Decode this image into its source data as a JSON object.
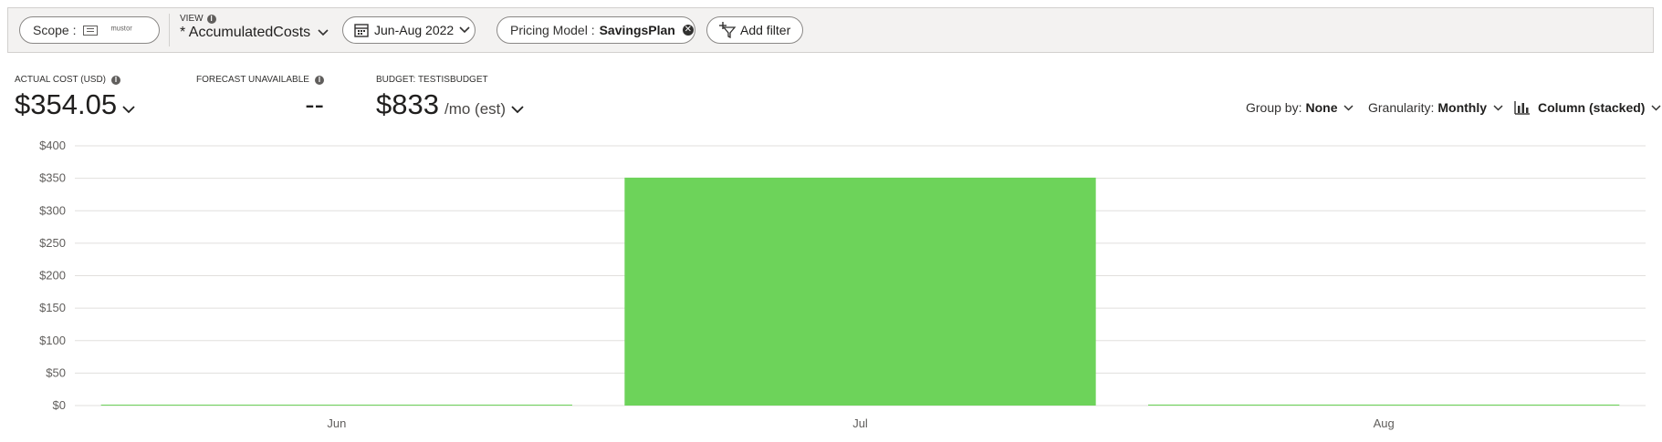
{
  "toolbar": {
    "scope_label": "Scope :",
    "scope_value": "ᵐᵘˢᵗᵒʳ",
    "view_caption": "VIEW",
    "view_name": "* AccumulatedCosts",
    "date_range": "Jun-Aug 2022",
    "filter_label": "Pricing Model :",
    "filter_value": "SavingsPlan",
    "add_filter_label": "Add filter"
  },
  "kpis": {
    "actual_caption": "ACTUAL COST (USD)",
    "actual_value": "$354.05",
    "forecast_caption": "FORECAST UNAVAILABLE",
    "forecast_value": "--",
    "budget_caption": "BUDGET: TESTISBUDGET",
    "budget_value": "$833",
    "budget_suffix": "/mo (est)"
  },
  "controls": {
    "group_by_label": "Group by:",
    "group_by_value": "None",
    "granularity_label": "Granularity:",
    "granularity_value": "Monthly",
    "chart_type_value": "Column (stacked)"
  },
  "chart_data": {
    "type": "bar",
    "categories": [
      "Jun",
      "Jul",
      "Aug"
    ],
    "values": [
      0.3,
      351,
      1.5
    ],
    "ylim": [
      0,
      400
    ],
    "yticks": [
      0,
      50,
      100,
      150,
      200,
      250,
      300,
      350,
      400
    ],
    "ytick_labels": [
      "$0",
      "$50",
      "$100",
      "$150",
      "$200",
      "$250",
      "$300",
      "$350",
      "$400"
    ],
    "bar_color": "#6dd35a",
    "grid": true,
    "title": "",
    "xlabel": "",
    "ylabel": ""
  }
}
